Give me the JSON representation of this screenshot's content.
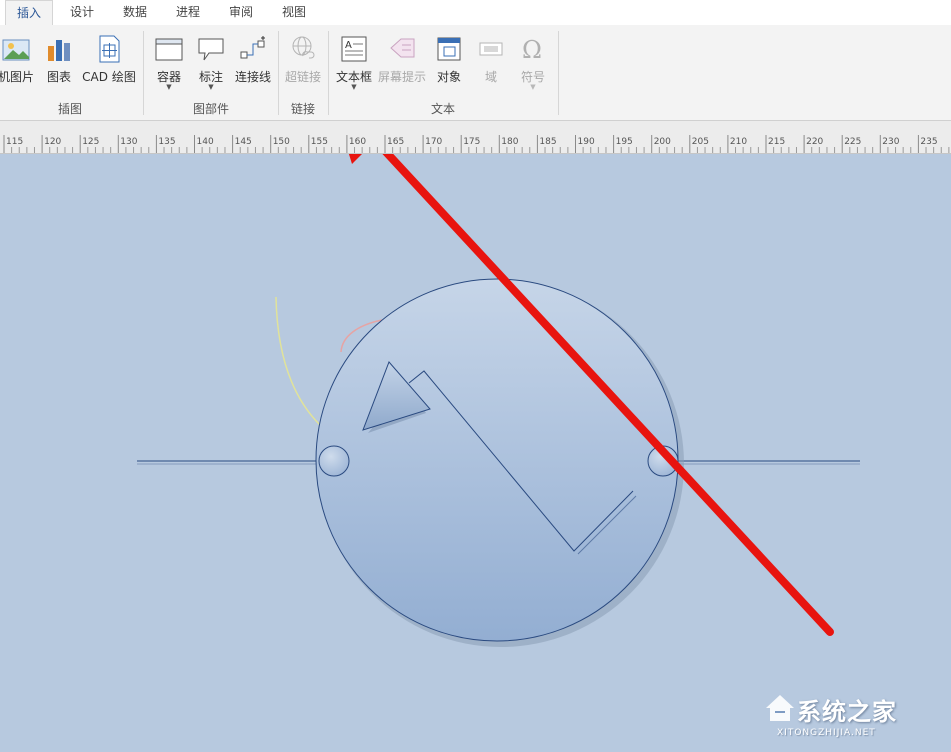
{
  "tabs": [
    {
      "label": "插入",
      "active": true
    },
    {
      "label": "设计",
      "active": false
    },
    {
      "label": "数据",
      "active": false
    },
    {
      "label": "进程",
      "active": false
    },
    {
      "label": "审阅",
      "active": false
    },
    {
      "label": "视图",
      "active": false
    }
  ],
  "ribbon": {
    "groups": {
      "illustrations": "插图",
      "diagram_parts": "图部件",
      "links": "链接",
      "text": "文本"
    },
    "buttons": {
      "online_picture": "机图片",
      "chart": "图表",
      "cad_drawing": "CAD 绘图",
      "container": "容器",
      "callout": "标注",
      "connector": "连接线",
      "hyperlink": "超链接",
      "textbox": "文本框",
      "screentip": "屏幕提示",
      "object": "对象",
      "field": "域",
      "symbol": "符号"
    }
  },
  "ruler": {
    "labels": [
      "115",
      "120",
      "125",
      "130",
      "135",
      "140",
      "145",
      "150",
      "155",
      "160",
      "165",
      "170",
      "175",
      "180",
      "185",
      "190",
      "195",
      "200",
      "205",
      "210",
      "215",
      "220",
      "225",
      "230",
      "235"
    ]
  },
  "watermark": {
    "brand": "系统之家",
    "url": "XITONGZHIJIA.NET"
  },
  "colors": {
    "accent_tab": "#2b5797",
    "canvas": "#b7c9df",
    "arrow": "#e8140f",
    "shape_stroke": "#2a4a80"
  },
  "icons": {
    "online_picture": "picture-icon",
    "chart": "bar-chart-icon",
    "cad_drawing": "cad-icon",
    "container": "container-icon",
    "callout": "callout-icon",
    "connector": "connector-icon",
    "hyperlink": "globe-link-icon",
    "textbox": "textbox-icon",
    "screentip": "screentip-icon",
    "object": "object-icon",
    "field": "field-icon",
    "symbol": "omega-icon"
  }
}
